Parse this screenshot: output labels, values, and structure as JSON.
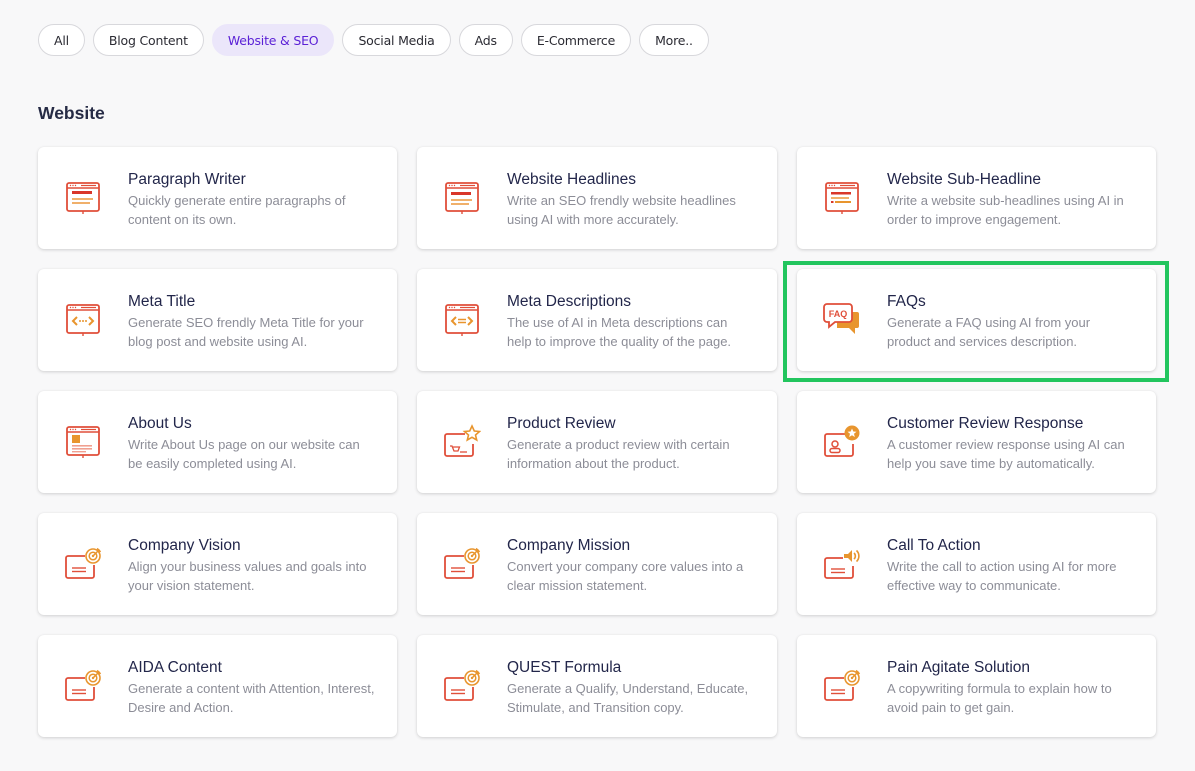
{
  "filters": [
    {
      "label": "All",
      "active": false
    },
    {
      "label": "Blog Content",
      "active": false
    },
    {
      "label": "Website & SEO",
      "active": true
    },
    {
      "label": "Social Media",
      "active": false
    },
    {
      "label": "Ads",
      "active": false
    },
    {
      "label": "E-Commerce",
      "active": false
    },
    {
      "label": "More..",
      "active": false
    }
  ],
  "section": {
    "title": "Website",
    "cards": [
      {
        "title": "Paragraph Writer",
        "desc_line1": "Quickly generate entire paragraphs of",
        "desc_line2": "content on its own.",
        "icon": "webpage-paragraph-icon"
      },
      {
        "title": "Website Headlines",
        "desc_line1": "Write an SEO frendly website headlines",
        "desc_line2": "using AI with more accurately.",
        "icon": "webpage-headline-icon"
      },
      {
        "title": "Website Sub-Headline",
        "desc_line1": "Write a website sub-headlines using AI in",
        "desc_line2": "order to improve engagement.",
        "icon": "webpage-subheadline-icon"
      },
      {
        "title": "Meta Title",
        "desc_line1": "Generate SEO frendly Meta Title for your",
        "desc_line2": "blog post and website using AI.",
        "icon": "webpage-code-icon"
      },
      {
        "title": "Meta Descriptions",
        "desc_line1": "The use of AI in Meta descriptions can",
        "desc_line2": "help to improve the quality of the page.",
        "icon": "webpage-code-equals-icon"
      },
      {
        "title": "FAQs",
        "desc_line1": "Generate a FAQ using AI from your",
        "desc_line2": "product and services description.",
        "icon": "faq-chat-icon"
      },
      {
        "title": "About Us",
        "desc_line1": "Write About Us page on our website can",
        "desc_line2": "be easily completed using AI.",
        "icon": "webpage-about-icon"
      },
      {
        "title": "Product Review",
        "desc_line1": "Generate a product review with certain",
        "desc_line2": "information about the product.",
        "icon": "product-star-icon"
      },
      {
        "title": "Customer Review Response",
        "desc_line1": "A customer review response using AI can",
        "desc_line2": "help you save time by automatically.",
        "icon": "customer-star-icon"
      },
      {
        "title": "Company Vision",
        "desc_line1": "Align your business values and goals into",
        "desc_line2": "your vision statement.",
        "icon": "target-card-icon"
      },
      {
        "title": "Company Mission",
        "desc_line1": "Convert your company core values into a",
        "desc_line2": "clear mission statement.",
        "icon": "target-card-icon"
      },
      {
        "title": "Call To Action",
        "desc_line1": "Write the call to action using AI for more",
        "desc_line2": "effective way to communicate.",
        "icon": "megaphone-card-icon"
      },
      {
        "title": "AIDA Content",
        "desc_line1": "Generate a content with Attention, Interest,",
        "desc_line2": "Desire and Action.",
        "icon": "target-card-icon"
      },
      {
        "title": "QUEST Formula",
        "desc_line1": "Generate a Qualify, Understand, Educate,",
        "desc_line2": "Stimulate, and Transition copy.",
        "icon": "target-card-icon"
      },
      {
        "title": "Pain Agitate Solution",
        "desc_line1": "A copywriting formula to explain how to",
        "desc_line2": "avoid pain to get gain.",
        "icon": "target-card-icon"
      }
    ]
  },
  "faq_icon_text": "FAQ",
  "highlighted_card": "FAQs",
  "colors": {
    "accent": "#5b21d6",
    "accent_bg": "#ebe6fa",
    "icon_red": "#e04f3a",
    "icon_orange": "#e8952e",
    "highlight": "#22c55e"
  }
}
